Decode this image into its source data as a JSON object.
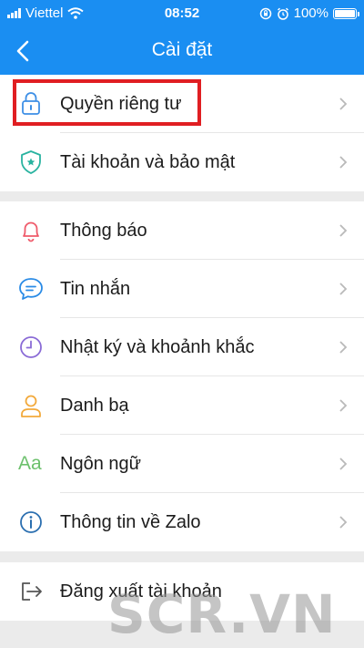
{
  "status_bar": {
    "carrier": "Viettel",
    "time": "08:52",
    "battery": "100%",
    "battery_level": 1.0
  },
  "header": {
    "title": "Cài đặt",
    "back_icon": "chevron-left-icon"
  },
  "sections": [
    {
      "items": [
        {
          "label": "Quyền riêng tư",
          "icon": "lock-icon",
          "icon_color": "#3d8fe6"
        },
        {
          "label": "Tài khoản và bảo mật",
          "icon": "shield-icon",
          "icon_color": "#29b3a0"
        }
      ]
    },
    {
      "items": [
        {
          "label": "Thông báo",
          "icon": "bell-icon",
          "icon_color": "#ef5a6a"
        },
        {
          "label": "Tin nhắn",
          "icon": "chat-icon",
          "icon_color": "#2a8be6"
        },
        {
          "label": "Nhật ký và khoảnh khắc",
          "icon": "clock-icon",
          "icon_color": "#8a6bd6"
        },
        {
          "label": "Danh bạ",
          "icon": "person-icon",
          "icon_color": "#f2a93b"
        },
        {
          "label": "Ngôn ngữ",
          "icon": "language-icon",
          "icon_color": "#6cc06c",
          "icon_text": "Aa"
        },
        {
          "label": "Thông tin về Zalo",
          "icon": "info-icon",
          "icon_color": "#2b6fb0"
        }
      ]
    },
    {
      "items": [
        {
          "label": "Đăng xuất tài khoản",
          "icon": "logout-icon",
          "icon_color": "#555555"
        }
      ]
    }
  ],
  "watermark": "SCR.VN",
  "colors": {
    "header_bg": "#1a8ef2",
    "highlight_border": "#e01e22",
    "chevron": "#b9b9b9"
  }
}
